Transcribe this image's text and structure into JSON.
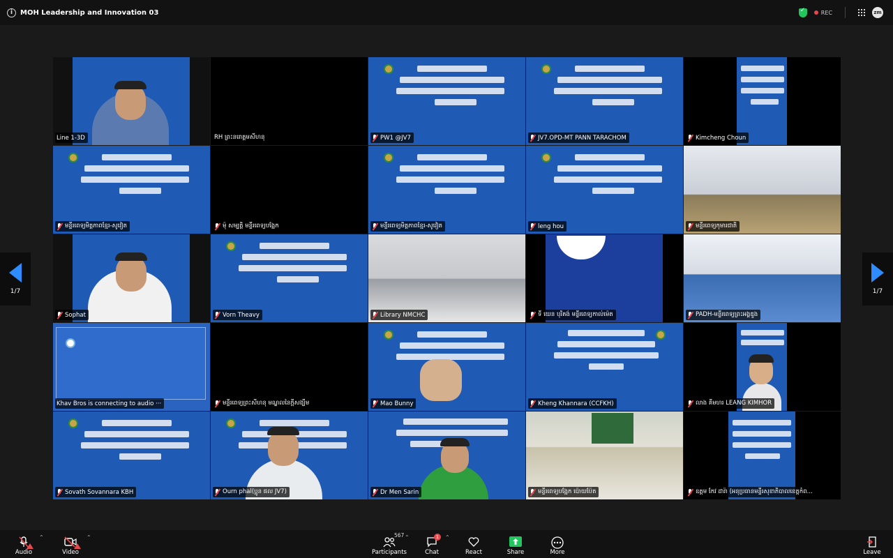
{
  "window": {
    "title": "MOH Leadership and Innovation 03",
    "rec_label": "REC",
    "avatar_text": "zm"
  },
  "navigation": {
    "page_indicator_left": "1/7",
    "page_indicator_right": "1/7"
  },
  "tiles": [
    "Line 1-3D",
    "RH ព្រះនរោត្តមសីហនុ",
    "PW1 @JV7",
    "JV7.OPD-MT PANN TARACHOM",
    "Kimcheng Choun",
    "មន្ទីរពេទ្យមិត្តភាពខ្មែរ-សូវៀត",
    "ម៉ុ សម្បត្តិ មន្ទីរពេទ្យបង្អែក",
    "មន្ទីរពេទ្យមិត្តភាពខ្មែរ-សូវៀត",
    "leng hou",
    "មន្ទីរពេទ្យកុមារជាតិ",
    "Sophat",
    "Vorn Theavy",
    "Library NMCHC",
    "ទី យេន បុរិគង់ មន្ទីរពេទ្យកាល់ម៉េត",
    "PADH-មន្ទីរពេទ្យព្រះអង្គឌួង",
    "Khav Bros is connecting to audio ···",
    "មន្ទីរពេទ្យព្រះសីហនុ មណ្ឌលនៃក្តីសង្ឃឹម",
    "Mao Bunny",
    "Kheng Khannara (CCFKH)",
    "លាង គីមហរ LEANG KIMHOR",
    "Sovath Sovannara KBH",
    "Ourn phal(ប្អូន ផល JV7)",
    "Dr Men Sarin",
    "មន្ទីរពេទ្យបង្អែក ប៉ោយប៉ែត",
    "ឧត្តម កែវ ដារ៉ា (អនុប្រធានមន្ទីរសុខាភិបាលខេត្តកំព..."
  ],
  "toolbar": {
    "audio": "Audio",
    "video": "Video",
    "participants": "Participants",
    "participants_count": "567",
    "chat": "Chat",
    "chat_badge": "1",
    "react": "React",
    "share": "Share",
    "more": "More",
    "leave": "Leave"
  },
  "colors": {
    "slide_blue": "#1f5bb5",
    "active_speaker": "#2ecc71",
    "share_green": "#23c55e",
    "alert_red": "#e5484d",
    "nav_blue": "#2f8cff"
  }
}
